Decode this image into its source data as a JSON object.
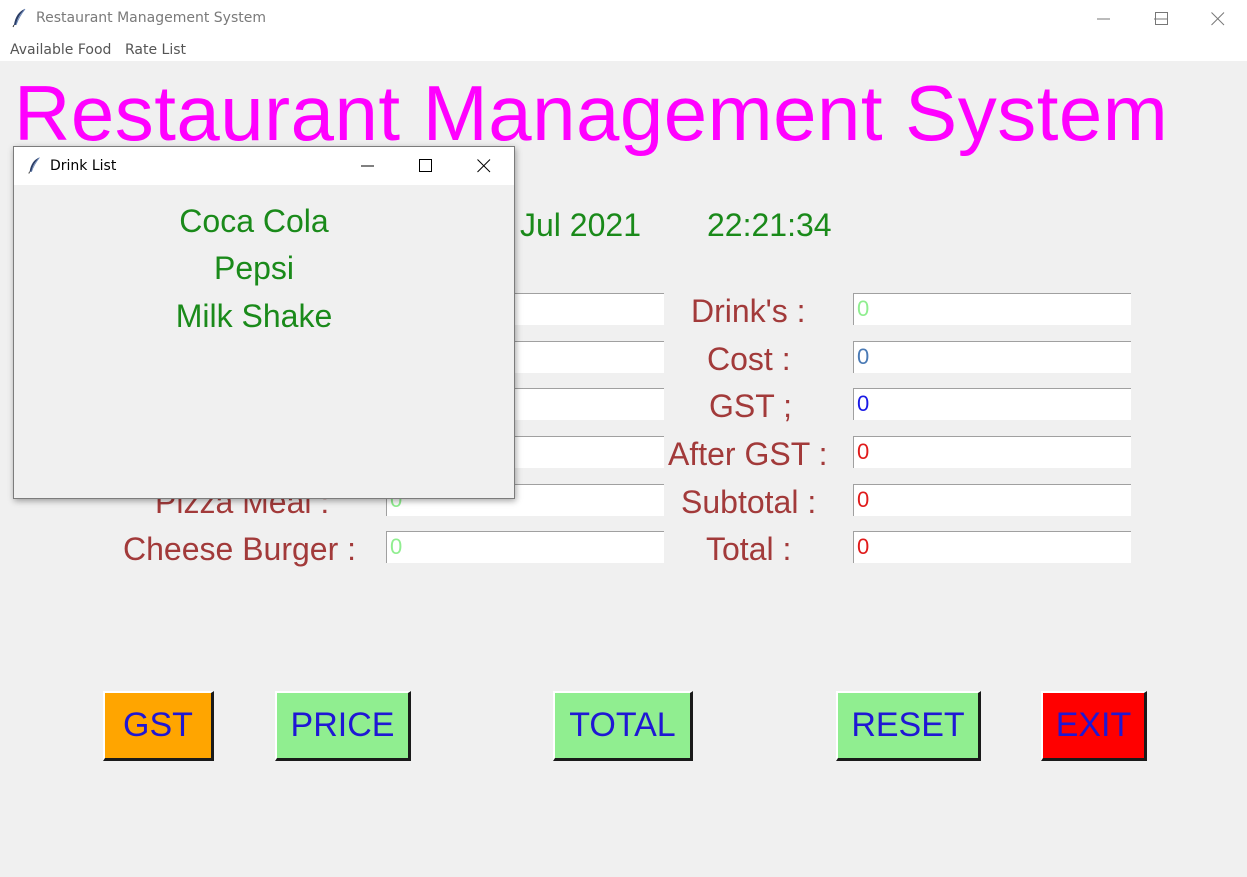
{
  "window": {
    "title": "Restaurant Management System",
    "minimize_label": "",
    "maximize_label": "",
    "close_label": ""
  },
  "menu": [
    {
      "label": "Available Food"
    },
    {
      "label": "Rate List"
    }
  ],
  "header": {
    "title": "Restaurant Management System",
    "date_partial": "Jul 2021",
    "time": "22:21:34"
  },
  "left_fields": [
    {
      "label": "Pizza Meal :",
      "value": "0",
      "color": "#90ee90"
    },
    {
      "label": "Cheese Burger :",
      "value": "0",
      "color": "#90ee90"
    }
  ],
  "right_fields": [
    {
      "label": "Drink's :",
      "value": "0",
      "color": "#90ee90"
    },
    {
      "label": "Cost :",
      "value": "0",
      "color": "#4a7ab5"
    },
    {
      "label": "GST ;",
      "value": "0",
      "color": "#1a1ae6"
    },
    {
      "label": "After GST :",
      "value": "0",
      "color": "#e01b1b"
    },
    {
      "label": "Subtotal :",
      "value": "0",
      "color": "#e01b1b"
    },
    {
      "label": "Total :",
      "value": "0",
      "color": "#e01b1b"
    }
  ],
  "hidden_field_values": [
    "",
    "",
    "",
    ""
  ],
  "buttons": [
    {
      "label": "GST",
      "bg": "#ffa500"
    },
    {
      "label": "PRICE",
      "bg": "#90ee90"
    },
    {
      "label": "TOTAL",
      "bg": "#90ee90"
    },
    {
      "label": "RESET",
      "bg": "#90ee90"
    },
    {
      "label": "EXIT",
      "bg": "#ff0000"
    }
  ],
  "popup": {
    "title": "Drink List",
    "items": [
      "Coca Cola",
      "Pepsi",
      "Milk Shake"
    ]
  },
  "icons": {
    "app": "feather-icon",
    "minimize": "minimize-icon",
    "maximize": "maximize-icon",
    "close": "close-icon"
  }
}
